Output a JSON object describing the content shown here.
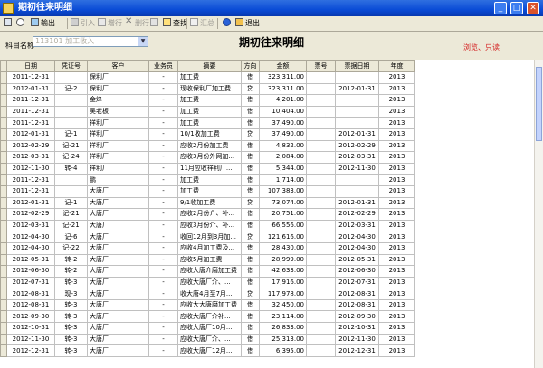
{
  "window": {
    "title": "期初往来明细",
    "min_label": "_",
    "max_label": "□",
    "close_label": "✕"
  },
  "toolbar": {
    "export": "输出",
    "import": "引入",
    "add": "增行",
    "delete": "删行",
    "find": "查找",
    "summary": "汇总",
    "exit": "退出"
  },
  "form": {
    "subject_label": "科目名称",
    "subject_value": "113101 加工收入",
    "page_title": "期初往来明细",
    "mode_label": "浏览、只读"
  },
  "table": {
    "columns": [
      "日期",
      "凭证号",
      "客户",
      "业务员",
      "摘要",
      "方向",
      "金额",
      "票号",
      "票据日期",
      "年度"
    ],
    "rows": [
      [
        "2011-12-31",
        "",
        "保利厂",
        "-",
        "加工费",
        "借",
        "323,311.00",
        "",
        "",
        "2013"
      ],
      [
        "2012-01-31",
        "记-2",
        "保利厂",
        "-",
        "现收保利厂加工费",
        "贷",
        "323,311.00",
        "",
        "2012-01-31",
        "2013"
      ],
      [
        "2011-12-31",
        "",
        "金烽",
        "-",
        "加工费",
        "借",
        "4,201.00",
        "",
        "",
        "2013"
      ],
      [
        "2011-12-31",
        "",
        "吴老板",
        "-",
        "加工费",
        "借",
        "10,404.00",
        "",
        "",
        "2013"
      ],
      [
        "2011-12-31",
        "",
        "祥利厂",
        "-",
        "加工费",
        "借",
        "37,490.00",
        "",
        "",
        "2013"
      ],
      [
        "2012-01-31",
        "记-1",
        "祥利厂",
        "-",
        "10/1收加工费",
        "贷",
        "37,490.00",
        "",
        "2012-01-31",
        "2013"
      ],
      [
        "2012-02-29",
        "记-21",
        "祥利厂",
        "-",
        "应收2月份加工费",
        "借",
        "4,832.00",
        "",
        "2012-02-29",
        "2013"
      ],
      [
        "2012-03-31",
        "记-24",
        "祥利厂",
        "-",
        "应收3月份外网加...",
        "借",
        "2,084.00",
        "",
        "2012-03-31",
        "2013"
      ],
      [
        "2012-11-30",
        "转-4",
        "祥利厂",
        "-",
        "11月应收祥利厂...",
        "借",
        "5,344.00",
        "",
        "2012-11-30",
        "2013"
      ],
      [
        "2011-12-31",
        "",
        "鹏",
        "-",
        "加工费",
        "借",
        "1,714.00",
        "",
        "",
        "2013"
      ],
      [
        "2011-12-31",
        "",
        "大唐厂",
        "-",
        "加工费",
        "借",
        "107,383.00",
        "",
        "",
        "2013"
      ],
      [
        "2012-01-31",
        "记-1",
        "大唐厂",
        "-",
        "9/1收加工费",
        "贷",
        "73,074.00",
        "",
        "2012-01-31",
        "2013"
      ],
      [
        "2012-02-29",
        "记-21",
        "大唐厂",
        "-",
        "应收2月份介、补...",
        "借",
        "20,751.00",
        "",
        "2012-02-29",
        "2013"
      ],
      [
        "2012-03-31",
        "记-21",
        "大唐厂",
        "-",
        "应收3月份介、补...",
        "借",
        "66,556.00",
        "",
        "2012-03-31",
        "2013"
      ],
      [
        "2012-04-30",
        "记-6",
        "大唐厂",
        "-",
        "收回12月到3月加...",
        "贷",
        "121,616.00",
        "",
        "2012-04-30",
        "2013"
      ],
      [
        "2012-04-30",
        "记-22",
        "大唐厂",
        "-",
        "应收4月加工费及...",
        "借",
        "28,430.00",
        "",
        "2012-04-30",
        "2013"
      ],
      [
        "2012-05-31",
        "转-2",
        "大唐厂",
        "-",
        "应收5月加工费",
        "借",
        "28,999.00",
        "",
        "2012-05-31",
        "2013"
      ],
      [
        "2012-06-30",
        "转-2",
        "大唐厂",
        "-",
        "应收大唐介磨加工费",
        "借",
        "42,633.00",
        "",
        "2012-06-30",
        "2013"
      ],
      [
        "2012-07-31",
        "转-3",
        "大唐厂",
        "-",
        "应收大唐厂介、...",
        "借",
        "17,916.00",
        "",
        "2012-07-31",
        "2013"
      ],
      [
        "2012-08-31",
        "现-3",
        "大唐厂",
        "-",
        "收大唐4月至7月...",
        "贷",
        "117,978.00",
        "",
        "2012-08-31",
        "2013"
      ],
      [
        "2012-08-31",
        "转-3",
        "大唐厂",
        "-",
        "应收大大唐磨加工费",
        "借",
        "32,450.00",
        "",
        "2012-08-31",
        "2013"
      ],
      [
        "2012-09-30",
        "转-3",
        "大唐厂",
        "-",
        "应收大唐厂介补...",
        "借",
        "23,114.00",
        "",
        "2012-09-30",
        "2013"
      ],
      [
        "2012-10-31",
        "转-3",
        "大唐厂",
        "-",
        "应收大唐厂10月...",
        "借",
        "26,833.00",
        "",
        "2012-10-31",
        "2013"
      ],
      [
        "2012-11-30",
        "转-3",
        "大唐厂",
        "-",
        "应收大唐厂介、...",
        "借",
        "25,313.00",
        "",
        "2012-11-30",
        "2013"
      ],
      [
        "2012-12-31",
        "转-3",
        "大唐厂",
        "-",
        "应收大唐厂12月...",
        "借",
        "6,395.00",
        "",
        "2012-12-31",
        "2013"
      ]
    ]
  }
}
